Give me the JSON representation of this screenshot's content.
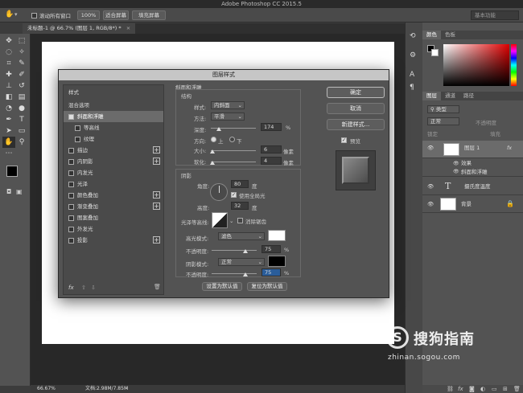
{
  "app": {
    "title": "Adobe Photoshop CC 2015.5"
  },
  "options": {
    "scroll_all_label": "滚动所有窗口",
    "zoom_btn": "100%",
    "fit_screen_btn": "适合屏幕",
    "fill_screen_btn": "填充屏幕",
    "workspace": "基本功能"
  },
  "document": {
    "tab_label": "未标题-1 @ 66.7% (图层 1, RGB/8*) *",
    "zoom": "66.67%",
    "doc_info": "文档:2.98M/7.85M"
  },
  "color_panel": {
    "tabs": [
      "颜色",
      "色板"
    ]
  },
  "layers_panel": {
    "tabs": [
      "图层",
      "通道",
      "路径"
    ],
    "kind_label": "类型",
    "blend_mode": "正常",
    "opacity_label": "不透明度",
    "lock_label": "锁定",
    "fill_label": "填充",
    "layers": [
      {
        "name": "图层 1",
        "fx": "fx"
      },
      {
        "name": "效果"
      },
      {
        "name": "斜面和浮雕"
      },
      {
        "name": "摄氏度温度"
      },
      {
        "name": "背景"
      }
    ]
  },
  "dialog": {
    "title": "图层样式",
    "styles_header": "样式",
    "blend_options": "混合选项",
    "list": [
      {
        "label": "斜面和浮雕",
        "checked": true,
        "selected": true,
        "plus": false
      },
      {
        "label": "等高线",
        "checked": false,
        "selected": false,
        "plus": false,
        "indent": true
      },
      {
        "label": "纹理",
        "checked": false,
        "selected": false,
        "plus": false,
        "indent": true
      },
      {
        "label": "描边",
        "checked": false,
        "plus": true
      },
      {
        "label": "内阴影",
        "checked": false,
        "plus": true
      },
      {
        "label": "内发光",
        "checked": false,
        "plus": false
      },
      {
        "label": "光泽",
        "checked": false,
        "plus": false
      },
      {
        "label": "颜色叠加",
        "checked": false,
        "plus": true
      },
      {
        "label": "渐变叠加",
        "checked": false,
        "plus": true
      },
      {
        "label": "图案叠加",
        "checked": false,
        "plus": false
      },
      {
        "label": "外发光",
        "checked": false,
        "plus": false
      },
      {
        "label": "投影",
        "checked": false,
        "plus": true
      }
    ],
    "fx_label": "fx",
    "bevel": {
      "section_title": "斜面和浮雕",
      "structure_title": "结构",
      "style_label": "样式:",
      "style_value": "内斜面",
      "technique_label": "方法:",
      "technique_value": "平滑",
      "depth_label": "深度:",
      "depth_value": "174",
      "depth_unit": "%",
      "depth_level": 0.17,
      "direction_label": "方向:",
      "direction_up": "上",
      "direction_down": "下",
      "size_label": "大小:",
      "size_value": "6",
      "size_unit": "像素",
      "size_level": 0.04,
      "soften_label": "软化:",
      "soften_value": "4",
      "soften_unit": "像素",
      "soften_level": 0.03
    },
    "shading": {
      "title": "阴影",
      "angle_label": "角度:",
      "angle_value": "80",
      "angle_unit": "度",
      "global_light_label": "使用全局光",
      "altitude_label": "高度:",
      "altitude_value": "32",
      "altitude_unit": "度",
      "gloss_label": "光泽等高线:",
      "antialias_label": "消除锯齿",
      "highlight_mode_label": "高光模式:",
      "highlight_mode_value": "滤色",
      "highlight_opacity_label": "不透明度:",
      "highlight_opacity_value": "75",
      "highlight_opacity_unit": "%",
      "highlight_opacity_level": 0.75,
      "shadow_mode_label": "阴影模式:",
      "shadow_mode_value": "正常",
      "shadow_opacity_label": "不透明度:",
      "shadow_opacity_value": "75",
      "shadow_opacity_unit": "%",
      "shadow_opacity_level": 0.75,
      "highlight_color": "#ffffff",
      "shadow_color": "#000000"
    },
    "buttons": {
      "ok": "确定",
      "cancel": "取消",
      "new_style": "新建样式...",
      "preview": "预览",
      "set_default": "设置为默认值",
      "reset_default": "复位为默认值"
    }
  },
  "watermark": {
    "brand": "搜狗指南",
    "url": "zhinan.sogou.com"
  }
}
